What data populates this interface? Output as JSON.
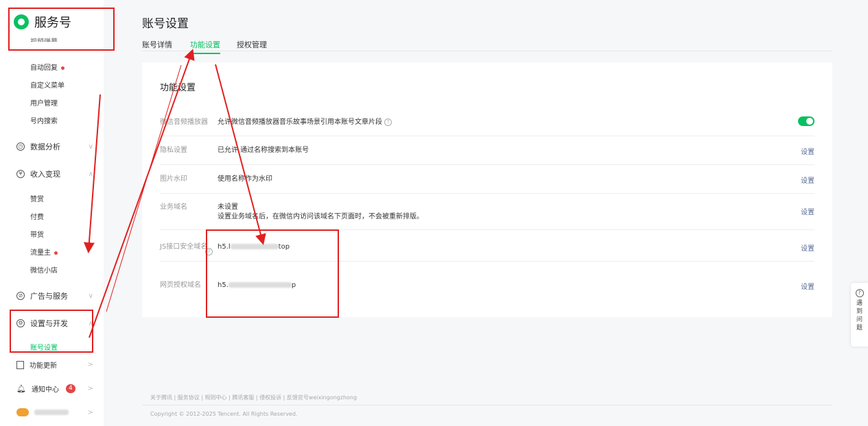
{
  "sidebar": {
    "brand": "服务号",
    "cut_item": "视频弹幕",
    "items_top": [
      {
        "label": "自动回复",
        "dot": true
      },
      {
        "label": "自定义菜单",
        "dot": false
      },
      {
        "label": "用户管理",
        "dot": false
      },
      {
        "label": "号内搜索",
        "dot": false
      }
    ],
    "groups": [
      {
        "label": "数据分析",
        "icon": "clock-icon",
        "chev": "∨"
      },
      {
        "label": "收入变现",
        "icon": "yuan-icon",
        "chev": "∧"
      },
      {
        "label": "广告与服务",
        "icon": "compass-icon",
        "chev": "∨"
      },
      {
        "label": "设置与开发",
        "icon": "gear-icon",
        "chev": "∧"
      },
      {
        "label": "功能更新",
        "icon": "update-icon",
        "chev": ">"
      },
      {
        "label": "通知中心",
        "icon": "bell-icon",
        "chev": ">",
        "badge": "4"
      }
    ],
    "revenue_items": [
      {
        "label": "赞赏",
        "dot": false
      },
      {
        "label": "付费",
        "dot": false
      },
      {
        "label": "带货",
        "dot": false
      },
      {
        "label": "流量主",
        "dot": true
      },
      {
        "label": "微信小店",
        "dot": false
      }
    ],
    "settings_items": [
      {
        "label": "账号设置"
      }
    ],
    "account_chev": ">"
  },
  "header": {
    "title": "账号设置",
    "tabs": [
      {
        "label": "账号详情"
      },
      {
        "label": "功能设置"
      },
      {
        "label": "授权管理"
      }
    ]
  },
  "card": {
    "title": "功能设置",
    "rows": [
      {
        "label": "微信音频播放器",
        "value": "允许微信音频播放器音乐故事场景引用本账号文章片段",
        "action": ""
      },
      {
        "label": "隐私设置",
        "value": "已允许 通过名称搜索到本账号",
        "action": "设置"
      },
      {
        "label": "图片水印",
        "value": "使用名称作为水印",
        "action": "设置"
      },
      {
        "label": "业务域名",
        "value": "未设置",
        "value2": "设置业务域名后，在微信内访问该域名下页面时，不会被重新排版。",
        "action": "设置"
      },
      {
        "label": "JS接口安全域名",
        "value_prefix": "h5.l",
        "value_suffix": "top",
        "action": "设置"
      },
      {
        "label": "网页授权域名",
        "value_prefix": "h5.",
        "value_suffix": "p",
        "action": "设置"
      }
    ]
  },
  "footer": {
    "links": "关于腾讯 | 服务协议 | 规则中心 | 腾讯客服 | 侵权投诉 | 反馈官号weixingongzhong",
    "copyright": "Copyright © 2012-2025 Tencent. All Rights Reserved."
  },
  "help": {
    "label": "遇到问题"
  },
  "annotation": {
    "color": "#e02020"
  }
}
